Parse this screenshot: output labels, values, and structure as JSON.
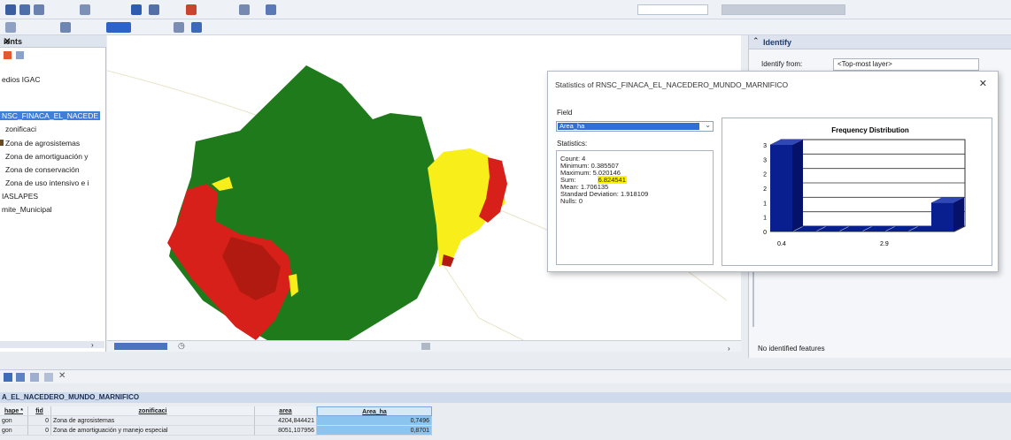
{
  "toc": {
    "title": "ients",
    "items": [
      {
        "label": "edios IGAC",
        "selected": false
      },
      {
        "label": "NSC_FINACA_EL_NACEDE",
        "selected": true
      },
      {
        "label": "zonificaci",
        "selected": false
      },
      {
        "label": "Zona de agrosistemas",
        "selected": false
      },
      {
        "label": "Zona de amortiguación y",
        "selected": false
      },
      {
        "label": "Zona de conservación",
        "selected": false
      },
      {
        "label": "Zona de uso intensivo e i",
        "selected": false
      },
      {
        "label": "IASLAPES",
        "selected": false
      },
      {
        "label": "mite_Municipal",
        "selected": false
      }
    ]
  },
  "identify": {
    "title": "Identify",
    "from_label": "Identify from:",
    "from_value": "<Top-most layer>",
    "status": "No identified features"
  },
  "stats_dialog": {
    "title": "Statistics of RNSC_FINACA_EL_NACEDERO_MUNDO_MARNIFICO",
    "field_label": "Field",
    "field_value": "Area_ha",
    "statistics_label": "Statistics:",
    "stats": {
      "count": "Count:    4",
      "minimum": "Minimum: 0.385507",
      "maximum": "Maximum: 5.020146",
      "sum_label": "Sum:",
      "sum_value": "6.824541",
      "mean": "Mean:      1.706135",
      "std": "Standard Deviation: 1.918109",
      "nulls": "Nulls:     0"
    }
  },
  "chart_data": {
    "type": "bar",
    "title": "Frequency Distribution",
    "categories": [
      "0.4",
      "2.9"
    ],
    "x_tick_labels": [
      "0.4",
      "2.9"
    ],
    "values": [
      3,
      0,
      0,
      0,
      0,
      0,
      0,
      1
    ],
    "ylim": [
      0,
      3
    ],
    "y_ticks": [
      "0",
      "1",
      "1",
      "2",
      "2",
      "3",
      "3"
    ],
    "grid": true,
    "legend": "none",
    "bar_color": "#0a1f8f"
  },
  "attribute_table": {
    "title": "A_EL_NACEDERO_MUNDO_MARNIFICO",
    "columns": [
      "hape *",
      "fid",
      "zonificaci",
      "area",
      "Area_ha"
    ],
    "rows": [
      [
        "gon",
        "0",
        "Zona de agrosistemas",
        "4204,844421",
        "0,7496"
      ],
      [
        "gon",
        "0",
        "Zona de amortiguación y manejo especial",
        "8051,107956",
        "0,8701"
      ]
    ]
  },
  "colors": {
    "map_green": "#1e7a1a",
    "map_red": "#d8201a",
    "map_darkred": "#b01a10",
    "map_yellow": "#f7ee1a",
    "selection_blue": "#3f7fd9"
  }
}
